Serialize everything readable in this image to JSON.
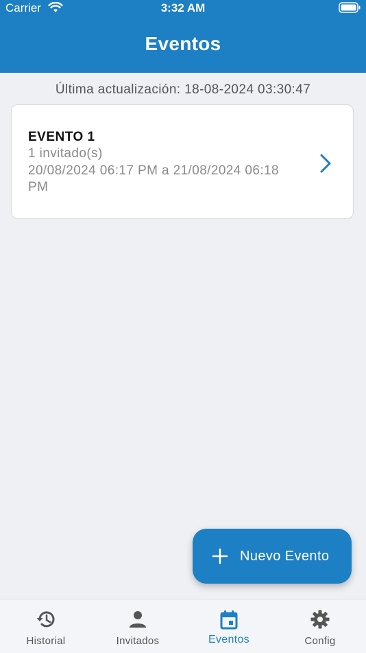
{
  "status_bar": {
    "carrier": "Carrier",
    "time": "3:32 AM"
  },
  "header": {
    "title": "Eventos"
  },
  "last_update": "Última actualización: 18-08-2024 03:30:47",
  "events": [
    {
      "title": "EVENTO 1",
      "guests": "1 invitado(s)",
      "dates": "20/08/2024 06:17 PM a 21/08/2024 06:18 PM"
    }
  ],
  "fab": {
    "label": "Nuevo Evento"
  },
  "tabs": [
    {
      "label": "Historial",
      "icon": "history-icon"
    },
    {
      "label": "Invitados",
      "icon": "person-icon"
    },
    {
      "label": "Eventos",
      "icon": "calendar-icon",
      "active": true
    },
    {
      "label": "Config",
      "icon": "gear-icon"
    }
  ],
  "colors": {
    "primary": "#1d7fc4",
    "background": "#eef0f4",
    "card": "#ffffff"
  }
}
